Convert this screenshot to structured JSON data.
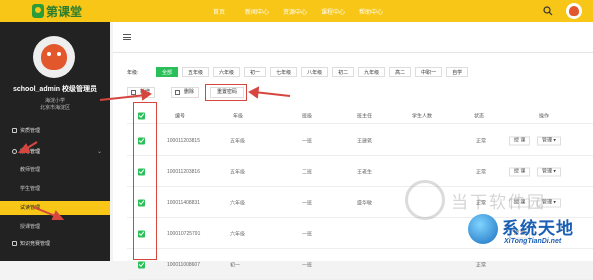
{
  "topbar": {
    "logo_text": "第课堂",
    "nav": [
      "首页",
      "新闻中心",
      "资源中心",
      "课程中心",
      "帮助中心"
    ]
  },
  "sidebar": {
    "username": "school_admin 校级管理员",
    "school": "海淀小学",
    "region": "北京市海淀区",
    "items": [
      {
        "label": "资质管理"
      },
      {
        "label": "账号管理"
      },
      {
        "label": "教师管理"
      },
      {
        "label": "学生管理"
      },
      {
        "label": "试读管理"
      },
      {
        "label": "授课管理"
      },
      {
        "label": "知识竞赛管理"
      }
    ]
  },
  "filters": {
    "grade_label": "年级:",
    "grades": [
      "全部",
      "五年级",
      "六年级",
      "初一",
      "七年级",
      "八年级",
      "初二",
      "九年级",
      "高二",
      "中职一",
      "自学"
    ]
  },
  "toolbar": {
    "add_label": "新增",
    "delete_label": "删除",
    "reset_password_label": "重置密码"
  },
  "table": {
    "headers": [
      "编号",
      "年级",
      "班级",
      "班主任",
      "学生人数",
      "状态",
      "操作"
    ],
    "rows": [
      {
        "id": "10001120381​5",
        "grade": "五年级",
        "class": "一班",
        "teacher": "王建筑",
        "count": "",
        "status": "正常"
      },
      {
        "id": "100011203816",
        "grade": "五年级",
        "class": "二班",
        "teacher": "王老生",
        "count": "",
        "status": "正常"
      },
      {
        "id": "100011408831",
        "grade": "六年级",
        "class": "一班",
        "teacher": "盛华敏",
        "count": "",
        "status": "正常"
      },
      {
        "id": "100010725791",
        "grade": "六年级",
        "class": "一班",
        "teacher": "",
        "count": "",
        "status": "正常"
      },
      {
        "id": "100011008607",
        "grade": "初一",
        "class": "一班",
        "teacher": "",
        "count": "",
        "status": "正常"
      }
    ],
    "action_teach": "授 课",
    "action_manage": "管理"
  },
  "watermarks": {
    "brand1": "当下软件园",
    "brand2": "系统天地",
    "brand2_sub": "XiTongTianDi.net"
  },
  "colors": {
    "topbar": "#f7c616",
    "sidebar": "#222222",
    "accent_green": "#2bbf5a",
    "annotation_red": "#d6463f"
  }
}
